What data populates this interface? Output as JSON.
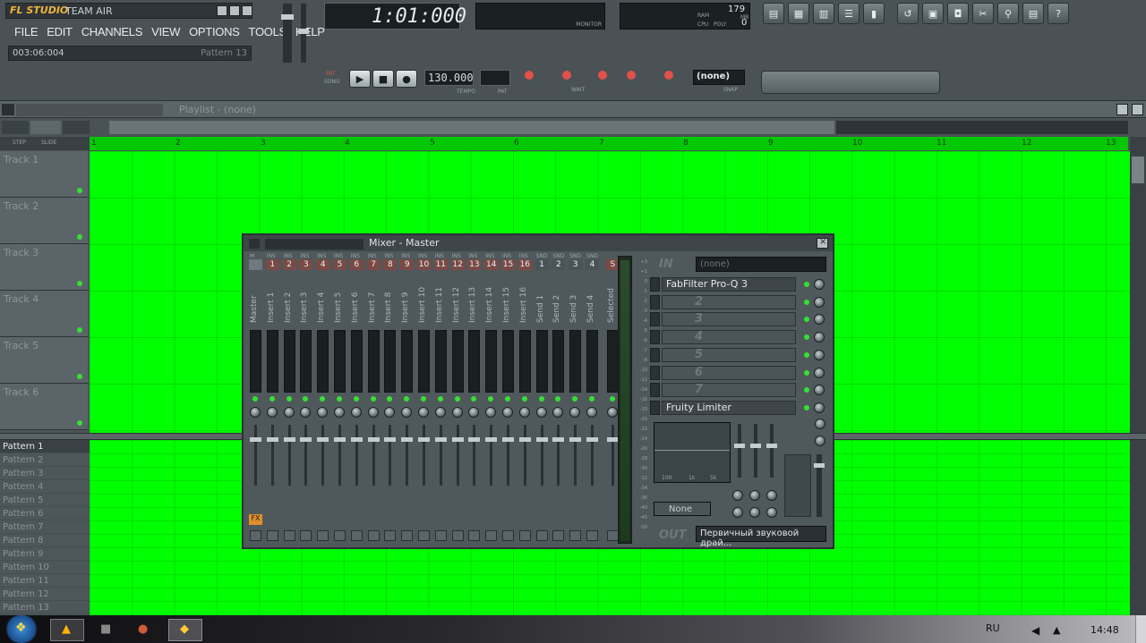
{
  "app": {
    "logo": "FL STUDIO",
    "title": "TEAM AIR"
  },
  "menu": [
    "FILE",
    "EDIT",
    "CHANNELS",
    "VIEW",
    "OPTIONS",
    "TOOLS",
    "HELP"
  ],
  "hint": {
    "position": "003:06:004",
    "pattern": "Pattern 13"
  },
  "time": {
    "display": "1:01:000",
    "monitor": "MONITOR"
  },
  "stats": {
    "cpu_label": "CPU",
    "poly_label": "POLY",
    "poly": "0",
    "ram_label": "RAM",
    "mb_label": "MB",
    "mem": "179"
  },
  "transport": {
    "pat": "PAT",
    "song": "SONG",
    "tempo": "130.000",
    "tempo_label": "TEMPO",
    "pat_label": "PAT",
    "snap": "(none)",
    "snap_label": "SNAP",
    "wait": "WAIT"
  },
  "playlist": {
    "title": "Playlist - (none)",
    "step": "STEP",
    "slide": "SLIDE",
    "ruler": [
      "1",
      "2",
      "3",
      "4",
      "5",
      "6",
      "7",
      "8",
      "9",
      "10",
      "11",
      "12",
      "13"
    ],
    "tracks": [
      "Track 1",
      "Track 2",
      "Track 3",
      "Track 4",
      "Track 5",
      "Track 6"
    ],
    "patterns": [
      "Pattern 1",
      "Pattern 2",
      "Pattern 3",
      "Pattern 4",
      "Pattern 5",
      "Pattern 6",
      "Pattern 7",
      "Pattern 8",
      "Pattern 9",
      "Pattern 10",
      "Pattern 11",
      "Pattern 12",
      "Pattern 13"
    ]
  },
  "mixer": {
    "title": "Mixer - Master",
    "strips": [
      "Master",
      "Insert 1",
      "Insert 2",
      "Insert 3",
      "Insert 4",
      "Insert 5",
      "Insert 6",
      "Insert 7",
      "Insert 8",
      "Insert 9",
      "Insert 10",
      "Insert 11",
      "Insert 12",
      "Insert 13",
      "Insert 14",
      "Insert 15",
      "Insert 16",
      "Send 1",
      "Send 2",
      "Send 3",
      "Send 4",
      "Selected"
    ],
    "strip_tags": [
      "M",
      "INS",
      "INS",
      "INS",
      "INS",
      "INS",
      "INS",
      "INS",
      "INS",
      "INS",
      "INS",
      "INS",
      "INS",
      "INS",
      "INS",
      "INS",
      "INS",
      "SND",
      "SND",
      "SND",
      "SND",
      ""
    ],
    "strip_nums": [
      "",
      "1",
      "2",
      "3",
      "4",
      "5",
      "6",
      "7",
      "8",
      "9",
      "10",
      "11",
      "12",
      "13",
      "14",
      "15",
      "16",
      "1",
      "2",
      "3",
      "4",
      "S"
    ],
    "in_label": "IN",
    "in_value": "(none)",
    "fx_slots": [
      "FabFilter Pro-Q 3",
      "2",
      "3",
      "4",
      "5",
      "6",
      "7",
      "Fruity Limiter"
    ],
    "eq_labels": [
      "100",
      "1k",
      "5k"
    ],
    "eq_preset": "None",
    "out_label": "OUT",
    "out_value": "Первичный звуковой драй...",
    "meter_scale": [
      "+3",
      "+1",
      "0",
      "-1",
      "-2",
      "-3",
      "-4",
      "-5",
      "-6",
      "-7",
      "-8",
      "-10",
      "-12",
      "-14",
      "-16",
      "-18",
      "-20",
      "-22",
      "-24",
      "-26",
      "-28",
      "-30",
      "-32",
      "-34",
      "-36",
      "-40",
      "-45",
      "-50"
    ],
    "fx_label": "FX"
  },
  "taskbar": {
    "lang": "RU",
    "clock": "14:48"
  }
}
